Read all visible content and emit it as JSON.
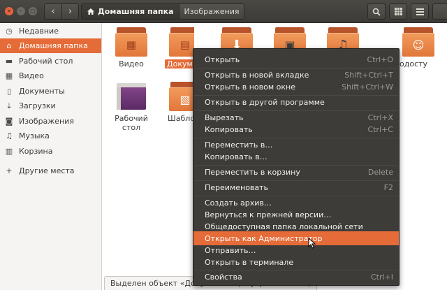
{
  "window": {
    "controls": {
      "close": "×",
      "minimize": "–",
      "maximize": "▢"
    }
  },
  "toolbar": {
    "back_icon": "‹",
    "forward_icon": "›",
    "breadcrumbs": [
      {
        "label": "Домашняя папка",
        "icon": "home-icon",
        "active": true
      },
      {
        "label": "Изображения",
        "active": false
      }
    ]
  },
  "sidebar": {
    "items": [
      {
        "label": "Недавние",
        "icon": "clock-icon",
        "selected": false
      },
      {
        "label": "Домашняя папка",
        "icon": "home-icon",
        "selected": true
      },
      {
        "label": "Рабочий стол",
        "icon": "desktop-icon",
        "selected": false
      },
      {
        "label": "Видео",
        "icon": "video-icon",
        "selected": false
      },
      {
        "label": "Документы",
        "icon": "document-icon",
        "selected": false
      },
      {
        "label": "Загрузки",
        "icon": "download-icon",
        "selected": false
      },
      {
        "label": "Изображения",
        "icon": "camera-icon",
        "selected": false
      },
      {
        "label": "Музыка",
        "icon": "music-icon",
        "selected": false
      },
      {
        "label": "Корзина",
        "icon": "trash-icon",
        "selected": false
      },
      {
        "label": "Другие места",
        "icon": "plus-icon",
        "selected": false
      }
    ]
  },
  "files": [
    {
      "label": "Видео",
      "type": "video-folder"
    },
    {
      "label": "Докуме",
      "type": "documents-folder",
      "selected": true
    },
    {
      "label": "",
      "type": "downloads-folder"
    },
    {
      "label": "",
      "type": "pictures-folder"
    },
    {
      "label": "",
      "type": "music-folder"
    },
    {
      "label": "одосту",
      "type": "public-folder"
    },
    {
      "label": "Рабочий стол",
      "type": "desktop-folder"
    },
    {
      "label": "Шабло",
      "type": "templates-folder"
    }
  ],
  "status": {
    "text": "Выделен объект «Документы» (внутри 1 объект)"
  },
  "context_menu": {
    "items": [
      {
        "label": "Открыть",
        "shortcut": "Ctrl+O"
      },
      {
        "label": "Открыть в новой вкладке",
        "shortcut": "Shift+Ctrl+T"
      },
      {
        "label": "Открыть в новом окне",
        "shortcut": "Shift+Ctrl+W"
      },
      {
        "label": "Открыть в другой программе",
        "shortcut": ""
      },
      {
        "label": "Вырезать",
        "shortcut": "Ctrl+X"
      },
      {
        "label": "Копировать",
        "shortcut": "Ctrl+C"
      },
      {
        "label": "Переместить в…",
        "shortcut": ""
      },
      {
        "label": "Копировать в…",
        "shortcut": ""
      },
      {
        "label": "Переместить в корзину",
        "shortcut": "Delete"
      },
      {
        "label": "Переименовать",
        "shortcut": "F2"
      },
      {
        "label": "Создать архив…",
        "shortcut": ""
      },
      {
        "label": "Вернуться к прежней версии…",
        "shortcut": ""
      },
      {
        "label": "Общедоступная папка локальной сети",
        "shortcut": ""
      },
      {
        "label": "Открыть как Администратор",
        "shortcut": "",
        "highlighted": true
      },
      {
        "label": "Отправить…",
        "shortcut": ""
      },
      {
        "label": "Открыть в терминале",
        "shortcut": ""
      },
      {
        "label": "Свойства",
        "shortcut": "Ctrl+I"
      }
    ]
  },
  "colors": {
    "accent": "#e56b38",
    "header": "#3c3b37",
    "menu_bg": "#3d3c38",
    "folder": "#e2763a"
  }
}
